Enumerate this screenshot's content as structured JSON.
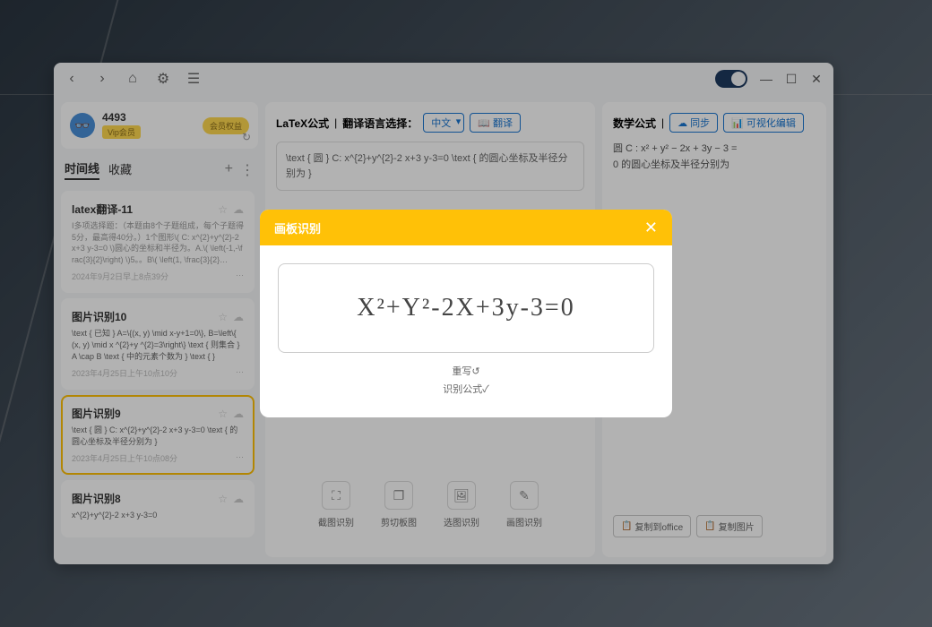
{
  "user": {
    "name": "4493",
    "vip": "Vip会员",
    "benefit": "会员权益"
  },
  "timeline": {
    "tabs": [
      "时间线",
      "收藏"
    ],
    "items": [
      {
        "title": "latex翻译-11",
        "content": "I多项选择题：（本题由8个子题组成，每个子题得5分，最高得40分。）1个图形\\( C: x^{2}+y^{2}-2 x+3 y-3=0 \\)圆心的坐标和半径为。A.\\( \\left(-1,-\\frac{3}{2}\\right) \\)5。。B\\( \\left(1, \\frac{3}{2}…",
        "date": "2024年9月2日早上8点39分"
      },
      {
        "title": "图片识别10",
        "content": "\\text { 已知 } A=\\{(x, y) \\mid x-y+1=0\\}, B=\\left\\{ (x, y) \\mid x ^{2}+y ^{2}=3\\right\\} \\text { 则集合 } A \\cap B \\text { 中的元素个数为 } \\text { }",
        "date": "2023年4月25日上午10点10分"
      },
      {
        "title": "图片识别9",
        "content": "\\text { 圆 } C: x^{2}+y^{2}-2 x+3 y-3=0 \\text { 的圆心坐标及半径分别为 }",
        "date": "2023年4月25日上午10点08分"
      },
      {
        "title": "图片识别8",
        "content": "x^{2}+y^{2}-2 x+3 y-3=0",
        "date": ""
      }
    ]
  },
  "center": {
    "latex_label": "LaTeX公式",
    "lang_label": "翻译语言选择：",
    "lang_value": "中文",
    "translate": "翻译",
    "latex_content": "\\text { 圆 } C: x^{2}+y^{2}-2 x+3 y-3=0 \\text { 的圆心坐标及半径分别为 }",
    "tools": [
      "截图识别",
      "剪切板图",
      "选图识别",
      "画图识别"
    ]
  },
  "right": {
    "math_label": "数学公式",
    "sync": "同步",
    "visual_edit": "可视化编辑",
    "formula_line1": "圆 C : x² + y² − 2x + 3y − 3 =",
    "formula_line2": "0 的圆心坐标及半径分别为",
    "copy_office": "复制到office",
    "copy_image": "复制图片"
  },
  "modal": {
    "title": "画板识别",
    "handwriting": "X²+Y²-2X+3y-3=0",
    "rewrite": "重写↺",
    "recognize": "识别公式✓"
  }
}
